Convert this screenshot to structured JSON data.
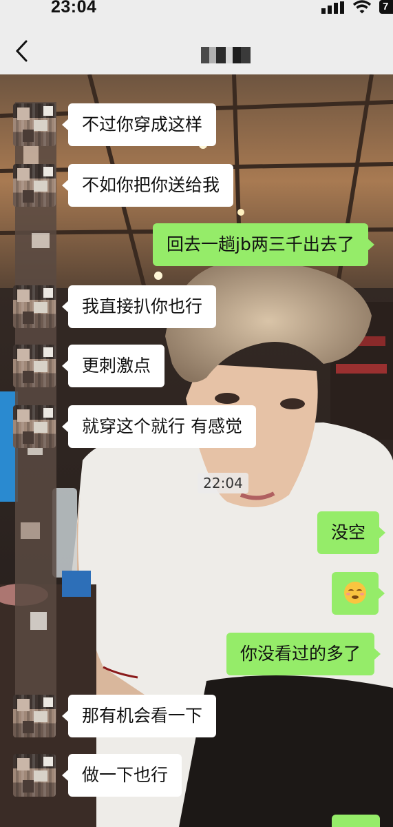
{
  "status_bar": {
    "time": "23:04",
    "battery": "7"
  },
  "nav": {
    "back_icon": "chevron-left-icon",
    "contact_name": "(pixelated name)"
  },
  "chat": {
    "timestamp": "22:04",
    "messages": [
      {
        "side": "left",
        "text": "不过你穿成这样"
      },
      {
        "side": "left",
        "text": "不如你把你送给我"
      },
      {
        "side": "right",
        "text": "回去一趟jb两三千出去了"
      },
      {
        "side": "left",
        "text": "我直接扒你也行"
      },
      {
        "side": "left",
        "text": "更刺激点"
      },
      {
        "side": "left",
        "text": "就穿这个就行 有感觉"
      },
      {
        "side": "right",
        "text": "没空"
      },
      {
        "side": "right",
        "text": "",
        "icon": "flushed-kiss-emoji-icon"
      },
      {
        "side": "right",
        "text": "你没看过的多了"
      },
      {
        "side": "left",
        "text": "那有机会看一下"
      },
      {
        "side": "left",
        "text": "做一下也行"
      }
    ]
  },
  "colors": {
    "incoming_bubble": "#ffffff",
    "outgoing_bubble": "#95ec69",
    "bar_background": "#ededed"
  }
}
